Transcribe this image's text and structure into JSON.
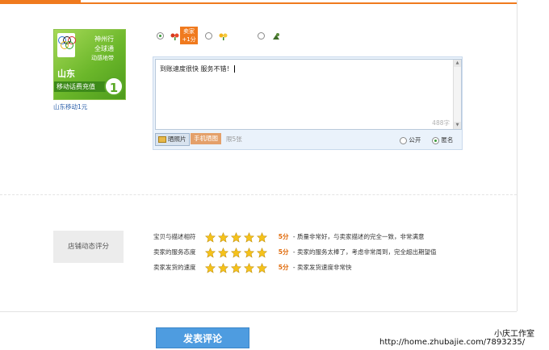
{
  "product": {
    "thumb_lines": [
      "神州行",
      "全球通",
      "动感地带"
    ],
    "thumb_region": "山东",
    "thumb_strip": "移动话费充值",
    "thumb_badge": "1",
    "caption": "山东移动1元"
  },
  "rating": {
    "options": [
      {
        "icon": "red-flower-icon",
        "checked": true
      },
      {
        "icon": "yellow-flower-icon",
        "checked": false
      },
      {
        "icon": "green-gift-icon",
        "checked": false
      }
    ],
    "tip_line1": "卖家",
    "tip_line2": "+1分"
  },
  "comment": {
    "text": "到账速度很快 服务不错！",
    "char_count": "488字",
    "photo_button": "晒照片",
    "phone_button": "手机晒图",
    "limit_text": "限5张",
    "public_label": "公开",
    "anonymous_label": "匿名",
    "visibility_selected": "anonymous"
  },
  "shop_rating": {
    "title": "店铺动态评分",
    "rows": [
      {
        "label": "宝贝与描述相符",
        "stars": 5,
        "score": "5分",
        "desc": "- 质量非常好，与卖家描述的完全一致，非常满意"
      },
      {
        "label": "卖家的服务态度",
        "stars": 5,
        "score": "5分",
        "desc": "- 卖家的服务太棒了，考虑非常周到，完全超出期望值"
      },
      {
        "label": "卖家发货的速度",
        "stars": 5,
        "score": "5分",
        "desc": "- 卖家发货速度非常快"
      }
    ]
  },
  "submit_label": "发表评论",
  "watermark": {
    "name": "小庆工作室",
    "url": "http://home.zhubajie.com/7893235/"
  },
  "colors": {
    "accent_orange": "#f07a1e",
    "submit_blue": "#4e9ce0",
    "score_orange": "#e06a0a",
    "star_yellow": "#f5c21b"
  }
}
